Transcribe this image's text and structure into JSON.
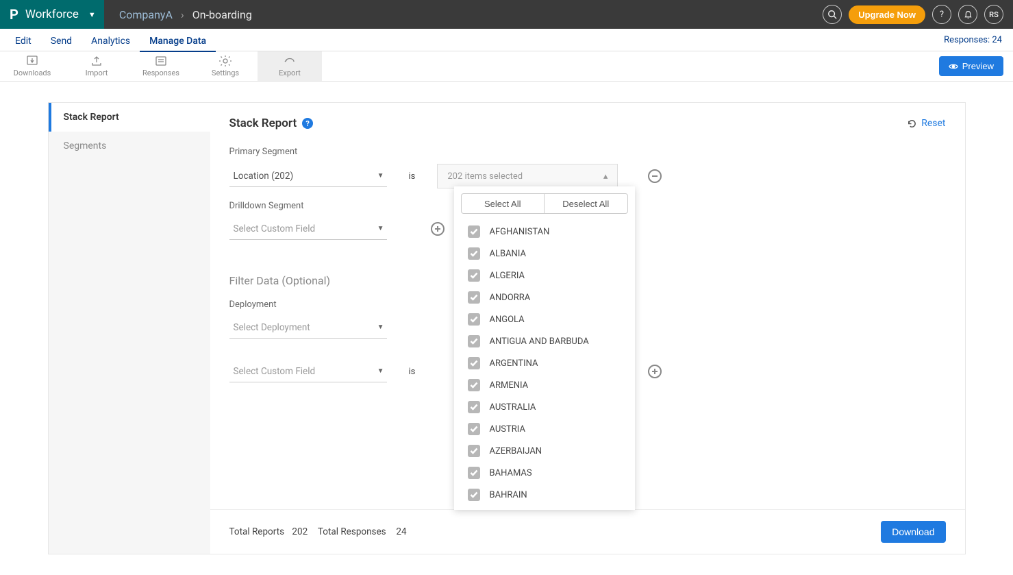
{
  "topbar": {
    "product": "Workforce",
    "breadcrumb_company": "CompanyA",
    "breadcrumb_page": "On-boarding",
    "upgrade": "Upgrade Now",
    "avatar_initials": "RS"
  },
  "nav": {
    "items": [
      "Edit",
      "Send",
      "Analytics",
      "Manage Data"
    ],
    "active_index": 3,
    "responses_label": "Responses:",
    "responses_count": "24"
  },
  "toolbar": {
    "items": [
      "Downloads",
      "Import",
      "Responses",
      "Settings",
      "Export"
    ],
    "active_index": 4,
    "preview": "Preview"
  },
  "sidebar": {
    "items": [
      "Stack Report",
      "Segments"
    ],
    "active_index": 0
  },
  "report": {
    "title": "Stack Report",
    "reset_label": "Reset",
    "primary_label": "Primary Segment",
    "primary_value": "Location (202)",
    "is_word": "is",
    "multiselect_value": "202 items selected",
    "drilldown_label": "Drilldown Segment",
    "drilldown_placeholder": "Select Custom Field",
    "filter_head": "Filter Data (Optional)",
    "deployment_label": "Deployment",
    "deployment_placeholder": "Select Deployment",
    "custom_placeholder": "Select Custom Field"
  },
  "dropdown": {
    "select_all": "Select All",
    "deselect_all": "Deselect All",
    "items": [
      "AFGHANISTAN",
      "ALBANIA",
      "ALGERIA",
      "ANDORRA",
      "ANGOLA",
      "ANTIGUA AND BARBUDA",
      "ARGENTINA",
      "ARMENIA",
      "AUSTRALIA",
      "AUSTRIA",
      "AZERBAIJAN",
      "BAHAMAS",
      "BAHRAIN"
    ]
  },
  "footer": {
    "reports_label": "Total Reports",
    "reports_value": "202",
    "responses_label": "Total Responses",
    "responses_value": "24",
    "download": "Download"
  }
}
